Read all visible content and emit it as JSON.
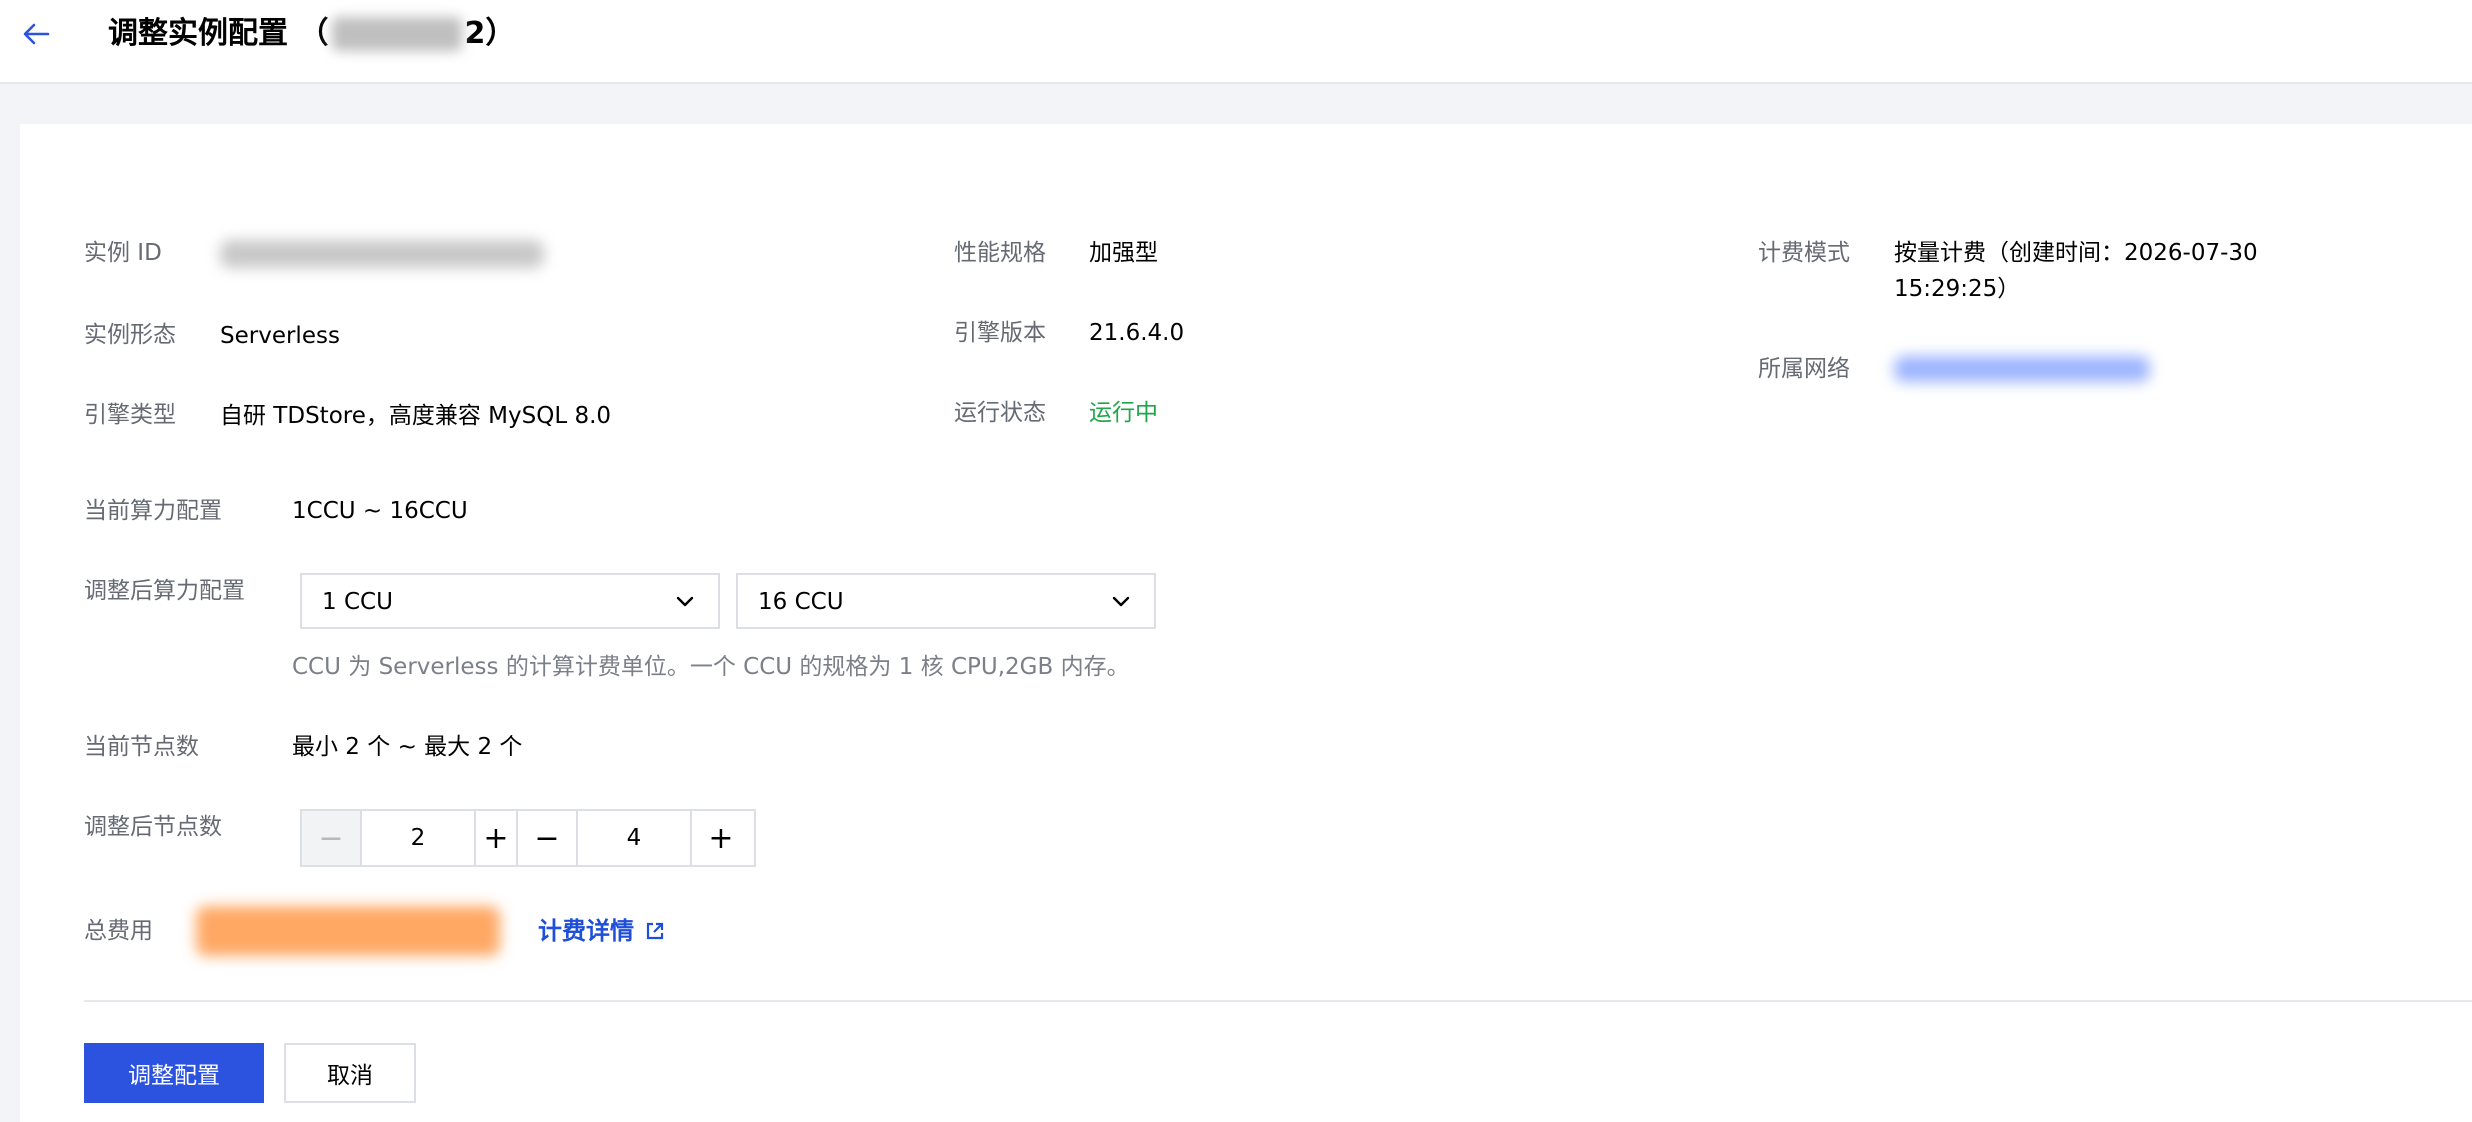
{
  "header": {
    "title_prefix": "调整实例配置 （",
    "title_suffix": "2）"
  },
  "info": {
    "instance_id_label": "实例 ID",
    "instance_form_label": "实例形态",
    "instance_form_value": "Serverless",
    "engine_type_label": "引擎类型",
    "engine_type_value": "自研 TDStore，高度兼容 MySQL 8.0",
    "spec_label": "性能规格",
    "spec_value": "加强型",
    "engine_version_label": "引擎版本",
    "engine_version_value": "21.6.4.0",
    "run_status_label": "运行状态",
    "run_status_value": "运行中",
    "billing_mode_label": "计费模式",
    "billing_mode_line1": "按量计费（创建时间：2026-07-30",
    "billing_mode_line2": "15:29:25）",
    "network_label": "所属网络"
  },
  "compute": {
    "current_label": "当前算力配置",
    "current_value": "1CCU ~ 16CCU",
    "adjust_label": "调整后算力配置",
    "min_select": "1 CCU",
    "max_select": "16 CCU",
    "hint": "CCU 为 Serverless 的计算计费单位。一个 CCU 的规格为 1 核 CPU,2GB 内存。"
  },
  "nodes": {
    "current_label": "当前节点数",
    "current_value": "最小 2 个 ~ 最大 2 个",
    "adjust_label": "调整后节点数",
    "min_value": "2",
    "max_value": "4",
    "minus_symbol": "−",
    "plus_symbol": "+"
  },
  "fee": {
    "label": "总费用",
    "link_label": "计费详情"
  },
  "actions": {
    "confirm_label": "调整配置",
    "cancel_label": "取消"
  },
  "colors": {
    "primary": "#2c52e0",
    "link": "#1f4fd8",
    "running": "#1fa64a",
    "fee_blur": "#ff9a4d",
    "network_blur": "#9db5ff"
  },
  "icons": {
    "back": "arrow-left-icon",
    "chevron": "chevron-down-icon",
    "external": "external-link-icon"
  }
}
